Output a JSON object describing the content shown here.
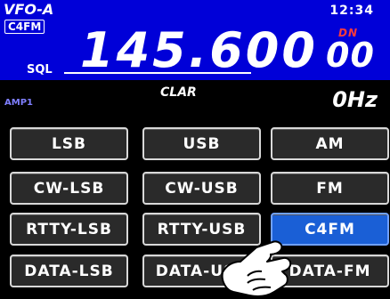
{
  "header": {
    "vfo": "VFO-A",
    "clock": "12:34",
    "mode_badge": "C4FM",
    "freq_main": "145.600",
    "freq_sub": "00",
    "dn": "DN",
    "sql_label": "SQL"
  },
  "info": {
    "amp": "AMP1",
    "clar_label": "CLAR",
    "clar_value": "0Hz"
  },
  "modes": [
    {
      "label": "LSB"
    },
    {
      "label": "USB"
    },
    {
      "label": "AM"
    },
    {
      "label": "CW-LSB"
    },
    {
      "label": "CW-USB"
    },
    {
      "label": "FM"
    },
    {
      "label": "RTTY-LSB"
    },
    {
      "label": "RTTY-USB"
    },
    {
      "label": "C4FM"
    },
    {
      "label": "DATA-LSB"
    },
    {
      "label": "DATA-USB"
    },
    {
      "label": "DATA-FM"
    }
  ],
  "colors": {
    "accent": "#1a5fd6",
    "header_bg": "#0000d8",
    "dn_color": "#ff3a3a"
  }
}
